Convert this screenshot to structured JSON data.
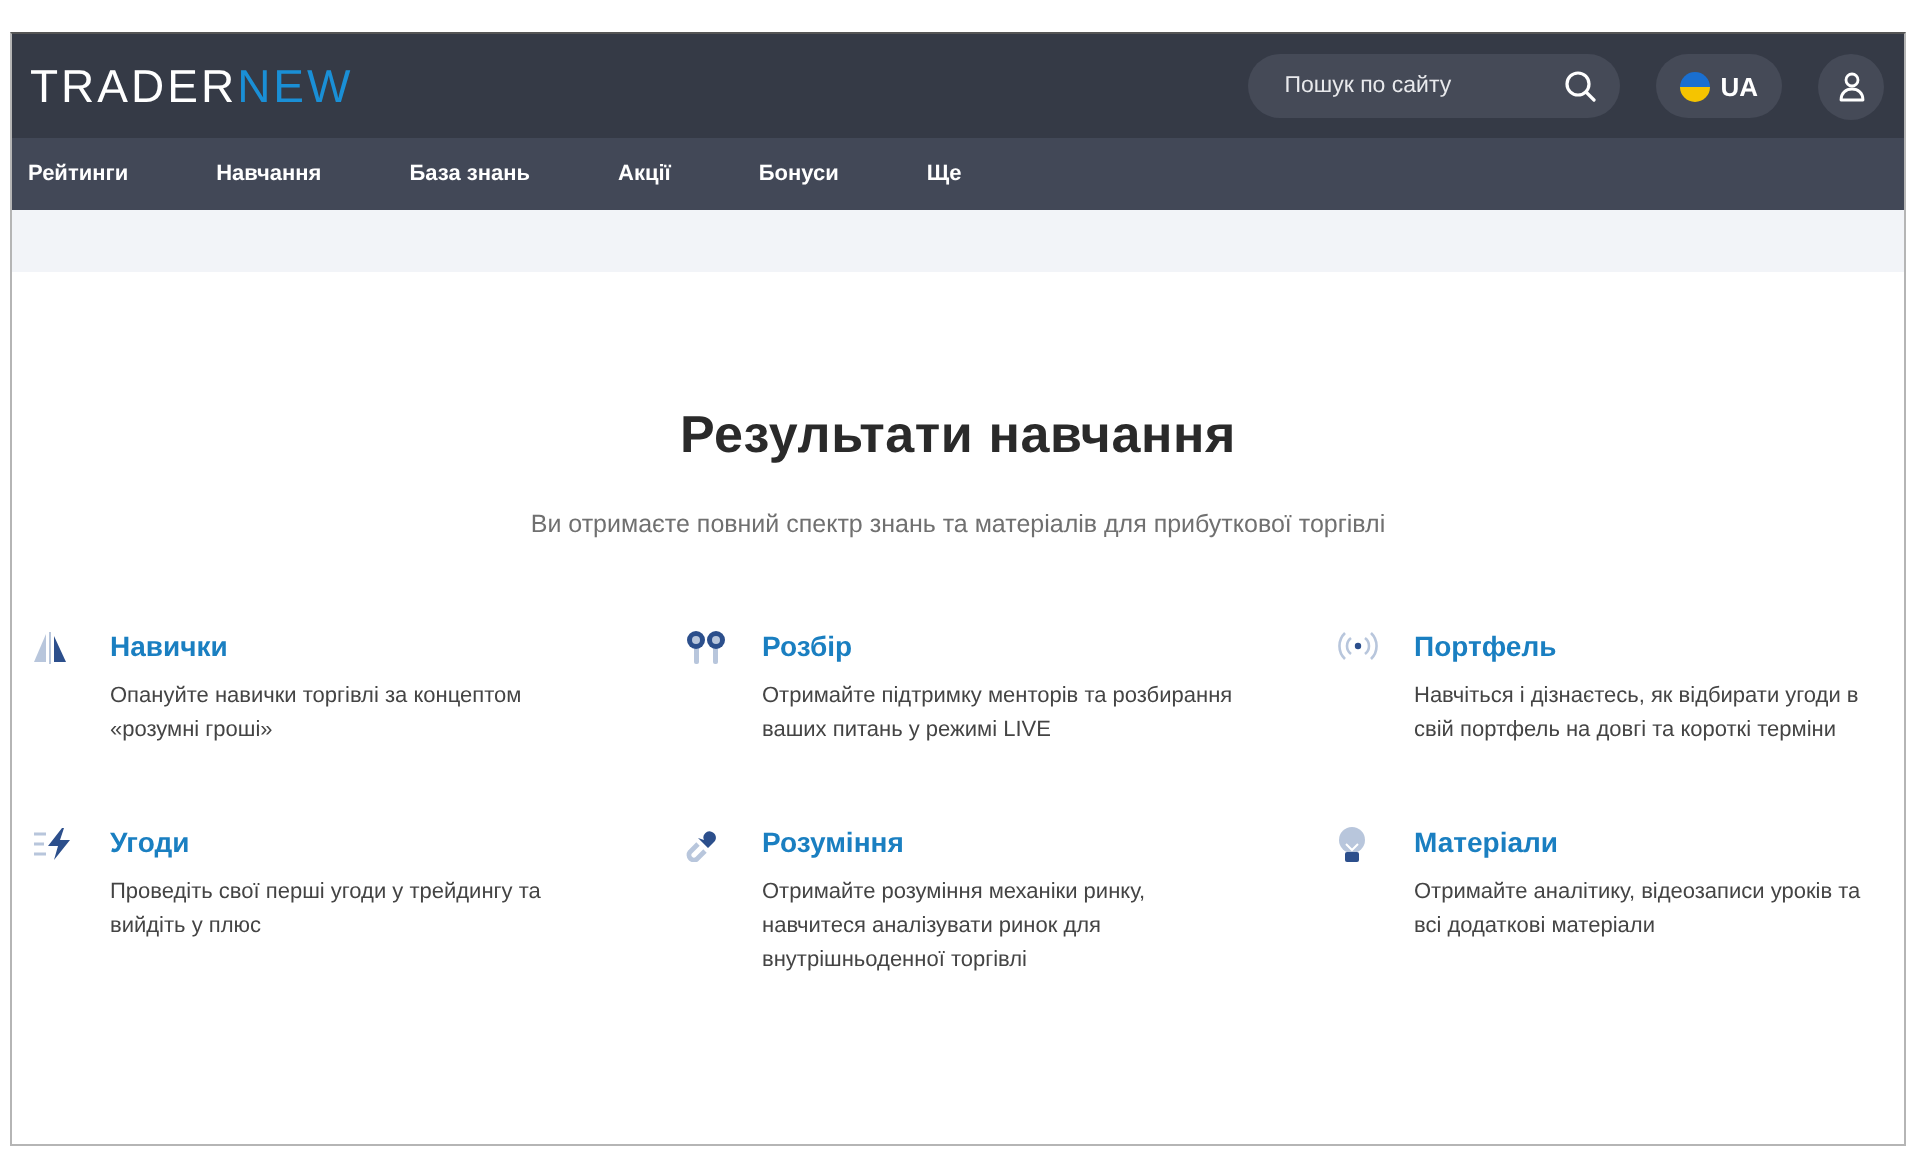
{
  "header": {
    "logo": {
      "first": "TRADER",
      "second": "NEW"
    },
    "search": {
      "placeholder": "Пошук по сайту"
    },
    "language": "UA"
  },
  "nav": [
    "Рейтинги",
    "Навчання",
    "База знань",
    "Акції",
    "Бонуси",
    "Ще"
  ],
  "section": {
    "title": "Результати навчання",
    "subtitle": "Ви отримаєте повний спектр знань та матеріалів для прибуткової торгівлі"
  },
  "features": [
    {
      "kind": "sail",
      "title": "Навички",
      "text": "Опануйте навички торгівлі за концептом «розумні гроші»"
    },
    {
      "kind": "earbuds",
      "title": "Розбір",
      "text": "Отримайте підтримку менторів та розбирання ваших питань у режимі LIVE"
    },
    {
      "kind": "signal",
      "title": "Портфель",
      "text": "Навчіться і дізнаєтесь, як відбирати угоди в свій портфель на довгі та короткі терміни"
    },
    {
      "kind": "bolt",
      "title": "Угоди",
      "text": "Проведіть свої перші угоди у трейдингу та вийдіть у плюс"
    },
    {
      "kind": "link",
      "title": "Розуміння",
      "text": "Отримайте розуміння механіки ринку, навчитеся аналізувати ринок для внутрішньоденної торгівлі"
    },
    {
      "kind": "bulb",
      "title": "Матеріали",
      "text": "Отримайте аналітику, відеозаписи уроків та всі додаткові матеріали"
    }
  ]
}
